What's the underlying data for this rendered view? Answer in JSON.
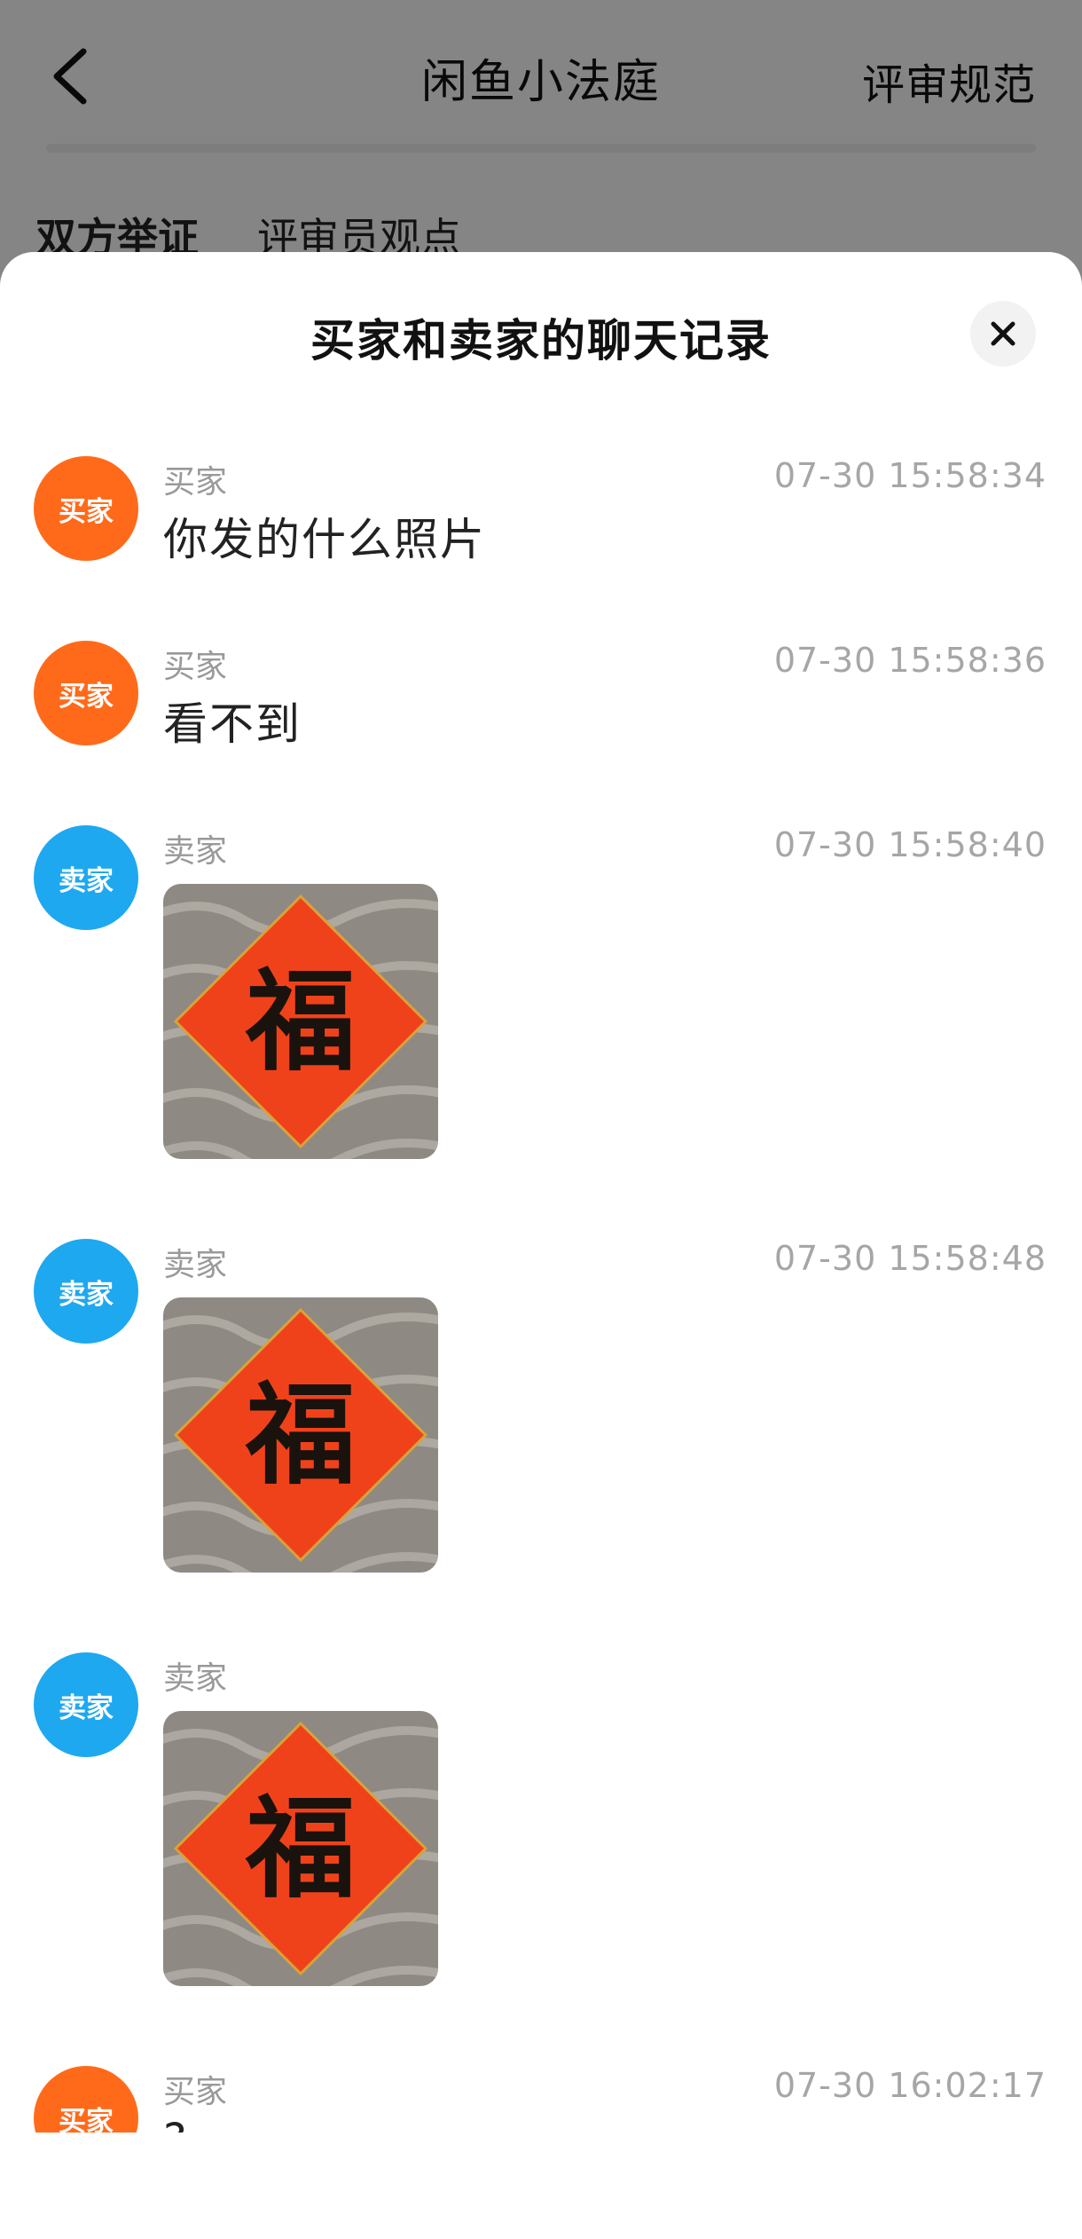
{
  "nav": {
    "title": "闲鱼小法庭",
    "right_link": "评审规范",
    "tabs": [
      {
        "label": "双方举证"
      },
      {
        "label": "评审员观点"
      }
    ]
  },
  "sheet": {
    "title": "买家和卖家的聊天记录",
    "close_icon": "close-icon"
  },
  "messages": [
    {
      "avatar": "买家",
      "sender": "买家",
      "time": "07-30 15:58:34",
      "text": "你发的什么照片"
    },
    {
      "avatar": "买家",
      "sender": "买家",
      "time": "07-30 15:58:36",
      "text": "看不到"
    },
    {
      "avatar": "卖家",
      "sender": "卖家",
      "time": "07-30 15:58:40",
      "image_char": "福"
    },
    {
      "avatar": "卖家",
      "sender": "卖家",
      "time": "07-30 15:58:48",
      "image_char": "福"
    },
    {
      "avatar": "卖家",
      "sender": "卖家",
      "time": "",
      "image_char": "福"
    },
    {
      "avatar": "买家",
      "sender": "买家",
      "time": "07-30 16:02:17",
      "text": "?"
    }
  ],
  "colors": {
    "buyer_avatar": "#ff6a1a",
    "seller_avatar": "#1ea8f0",
    "tab_highlight": "#ffe033",
    "fu_red": "#f0421a"
  }
}
